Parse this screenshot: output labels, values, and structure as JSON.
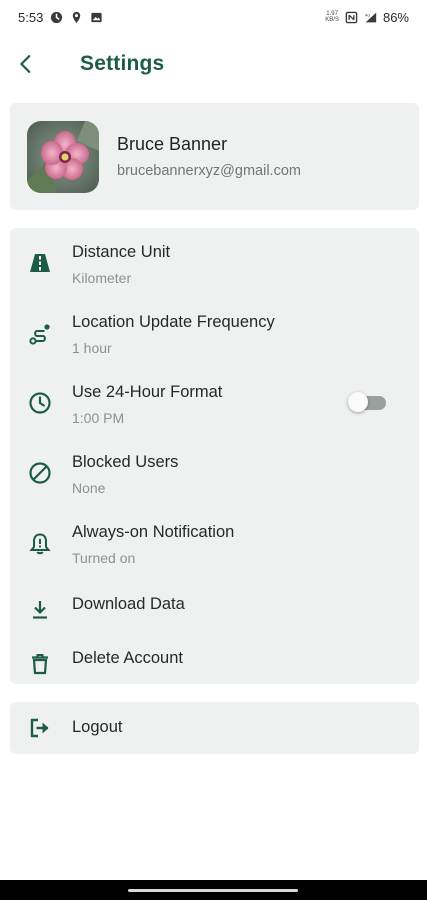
{
  "status_bar": {
    "time": "5:53",
    "net_speed_value": "1.97",
    "net_speed_unit": "KB/S",
    "battery": "86%"
  },
  "header": {
    "title": "Settings",
    "back_icon": "chevron-left-icon"
  },
  "profile": {
    "name": "Bruce Banner",
    "email": "brucebannerxyz@gmail.com",
    "avatar": "flower-photo"
  },
  "settings": [
    {
      "icon": "road-icon",
      "title": "Distance Unit",
      "subtitle": "Kilometer"
    },
    {
      "icon": "route-icon",
      "title": "Location Update Frequency",
      "subtitle": "1 hour"
    },
    {
      "icon": "clock-icon",
      "title": "Use 24-Hour Format",
      "subtitle": "1:00 PM",
      "toggle_on": false
    },
    {
      "icon": "block-icon",
      "title": "Blocked Users",
      "subtitle": "None"
    },
    {
      "icon": "bell-alert-icon",
      "title": "Always-on Notification",
      "subtitle": "Turned on"
    },
    {
      "icon": "download-icon",
      "title": "Download Data"
    },
    {
      "icon": "trash-icon",
      "title": "Delete Account"
    }
  ],
  "logout": {
    "icon": "logout-icon",
    "label": "Logout"
  },
  "colors": {
    "accent": "#1c5c47",
    "card_bg": "#eef1f0",
    "secondary_text": "#8b9390"
  }
}
